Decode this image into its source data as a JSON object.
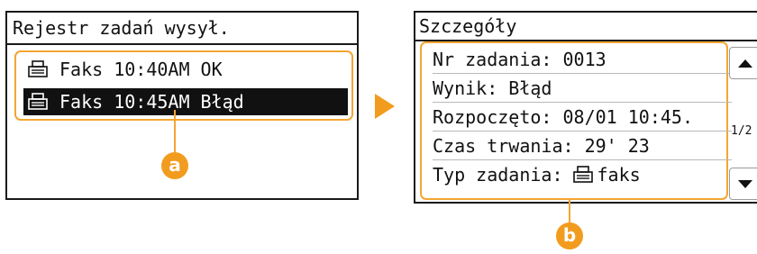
{
  "job_log": {
    "title": "Rejestr zadań wysył.",
    "rows": [
      {
        "type_icon": "fax-icon",
        "label": "Faks 10:40AM OK",
        "selected": false
      },
      {
        "type_icon": "fax-icon",
        "label": "Faks 10:45AM Błąd",
        "selected": true
      }
    ],
    "callout": "a"
  },
  "details": {
    "title": "Szczegóły",
    "rows": [
      "Nr zadania: 0013",
      "Wynik: Błąd",
      "Rozpoczęto: 08/01 10:45.",
      "Czas trwania: 29' 23"
    ],
    "job_type_label": "Typ zadania:",
    "job_type_icon": "fax-icon",
    "job_type_value": "faks",
    "page_indicator": "1/2",
    "callout": "b"
  },
  "colors": {
    "accent": "#f29c1f",
    "highlight_border": "#f4a533",
    "selected_row_bg": "#111111"
  }
}
